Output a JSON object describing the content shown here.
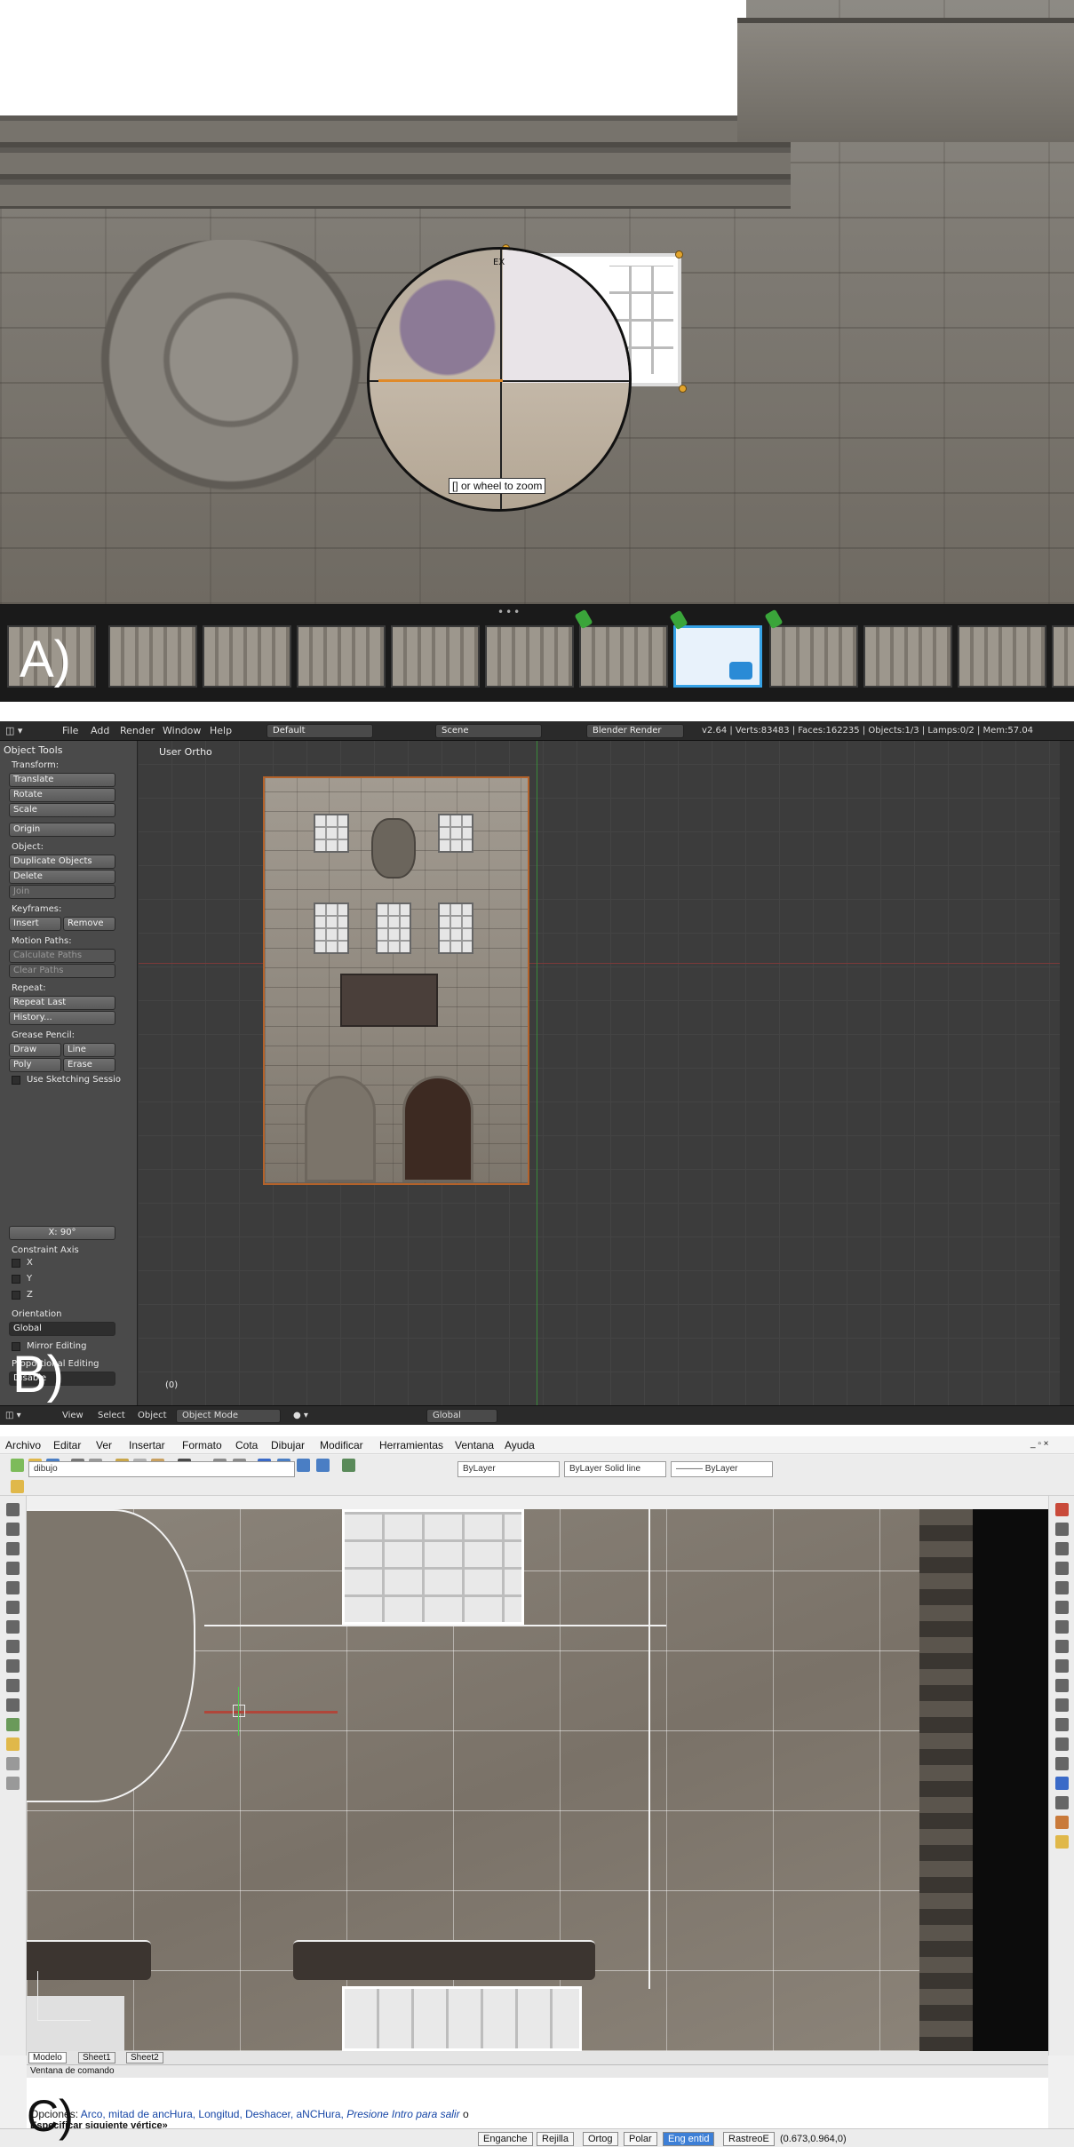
{
  "panel_a": {
    "label": "A)",
    "zoom_hint": "[] or wheel to zoom",
    "loupe_tag": "EX",
    "thumbnail_count": 12,
    "selected_thumbnail_index": 7
  },
  "panel_b": {
    "label": "B)",
    "menu": [
      "File",
      "Add",
      "Render",
      "Window",
      "Help"
    ],
    "layout_field": "Default",
    "scene_field": "Scene",
    "render_engine": "Blender Render",
    "stats": "v2.64 | Verts:83483 | Faces:162235 | Objects:1/3 | Lamps:0/2 | Mem:57.04",
    "viewport_label": "User Ortho",
    "object_tools": {
      "header": "Object Tools",
      "transform_label": "Transform:",
      "translate": "Translate",
      "rotate": "Rotate",
      "scale": "Scale",
      "origin": "Origin",
      "object_label": "Object:",
      "duplicate": "Duplicate Objects",
      "delete": "Delete",
      "join": "Join",
      "keyframes_label": "Keyframes:",
      "insert": "Insert",
      "remove": "Remove",
      "motion_paths_label": "Motion Paths:",
      "calculate_paths": "Calculate Paths",
      "clear_paths": "Clear Paths",
      "repeat_label": "Repeat:",
      "repeat_last": "Repeat Last",
      "history": "History...",
      "grease_label": "Grease Pencil:",
      "draw": "Draw",
      "line": "Line",
      "poly": "Poly",
      "erase": "Erase",
      "sketching": "Use Sketching Sessio"
    },
    "operator": {
      "x_field": "X: 90°",
      "constraint_label": "Constraint Axis",
      "x": "X",
      "y": "Y",
      "z": "Z",
      "orientation_label": "Orientation",
      "orientation_value": "Global",
      "mirror": "Mirror Editing",
      "proportional": "Proportional Editing",
      "disable": "Disable"
    },
    "frame_counter": "(0)",
    "bottom": {
      "view": "View",
      "select": "Select",
      "object": "Object",
      "mode": "Object Mode",
      "orientation": "Global"
    }
  },
  "panel_c": {
    "label": "C)",
    "menu": [
      "Archivo",
      "Editar",
      "Ver",
      "Insertar",
      "Formato",
      "Cota",
      "Dibujar",
      "Modificar",
      "Herramientas",
      "Ventana",
      "Ayuda"
    ],
    "layer_combo": "dibujo",
    "color_combo": "ByLayer",
    "linetype_combo": "ByLayer    Solid line",
    "lineweight_combo": "——— ByLayer",
    "tabs": [
      "Modelo",
      "Sheet1",
      "Sheet2"
    ],
    "command_window_title": "Ventana de comando",
    "command_prompt_label": "Opciones:",
    "command_options": "Arco, mitad de ancHura, Longitud, Deshacer, aNCHura,",
    "command_hint": "Presione Intro para salir",
    "command_tail": "o",
    "command_line2": "Especificar siguiente vértice»",
    "status_buttons": [
      "Enganche",
      "Rejilla",
      "Ortog",
      "Polar",
      "Eng entid",
      "RastreoE"
    ],
    "active_status_button": "Eng entid",
    "coordinates": "(0.673,0.964,0)"
  }
}
